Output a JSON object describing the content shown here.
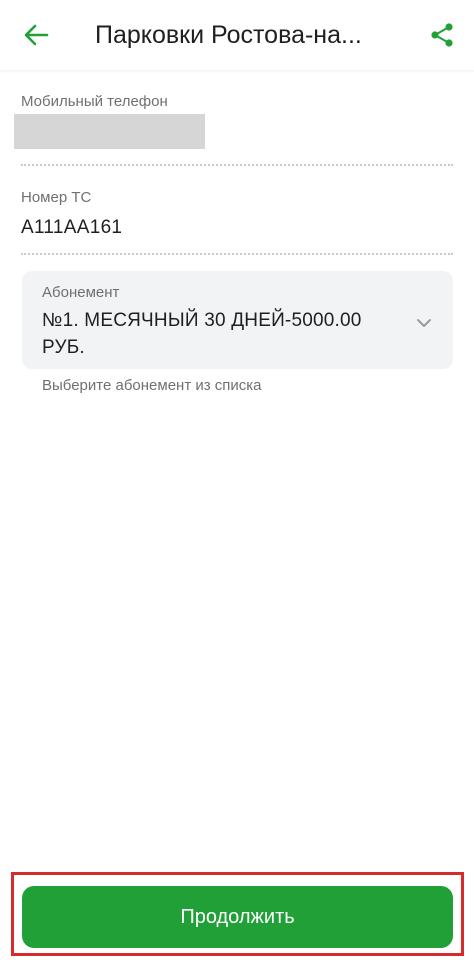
{
  "header": {
    "title": "Парковки Ростова-на...",
    "back_icon": "arrow-left-icon",
    "share_icon": "share-icon"
  },
  "form": {
    "phone": {
      "label": "Мобильный телефон"
    },
    "vehicle": {
      "label": "Номер ТС",
      "value": "А111АА161"
    },
    "subscription": {
      "label": "Абонемент",
      "value": "№1. МЕСЯЧНЫЙ 30 ДНЕЙ-5000.00 РУБ.",
      "helper": "Выберите абонемент из списка",
      "icon": "chevron-down-icon"
    }
  },
  "footer": {
    "continue_label": "Продолжить"
  },
  "colors": {
    "accent": "#21a038",
    "highlight": "#d72b2b",
    "select_bg": "#f2f3f5"
  }
}
